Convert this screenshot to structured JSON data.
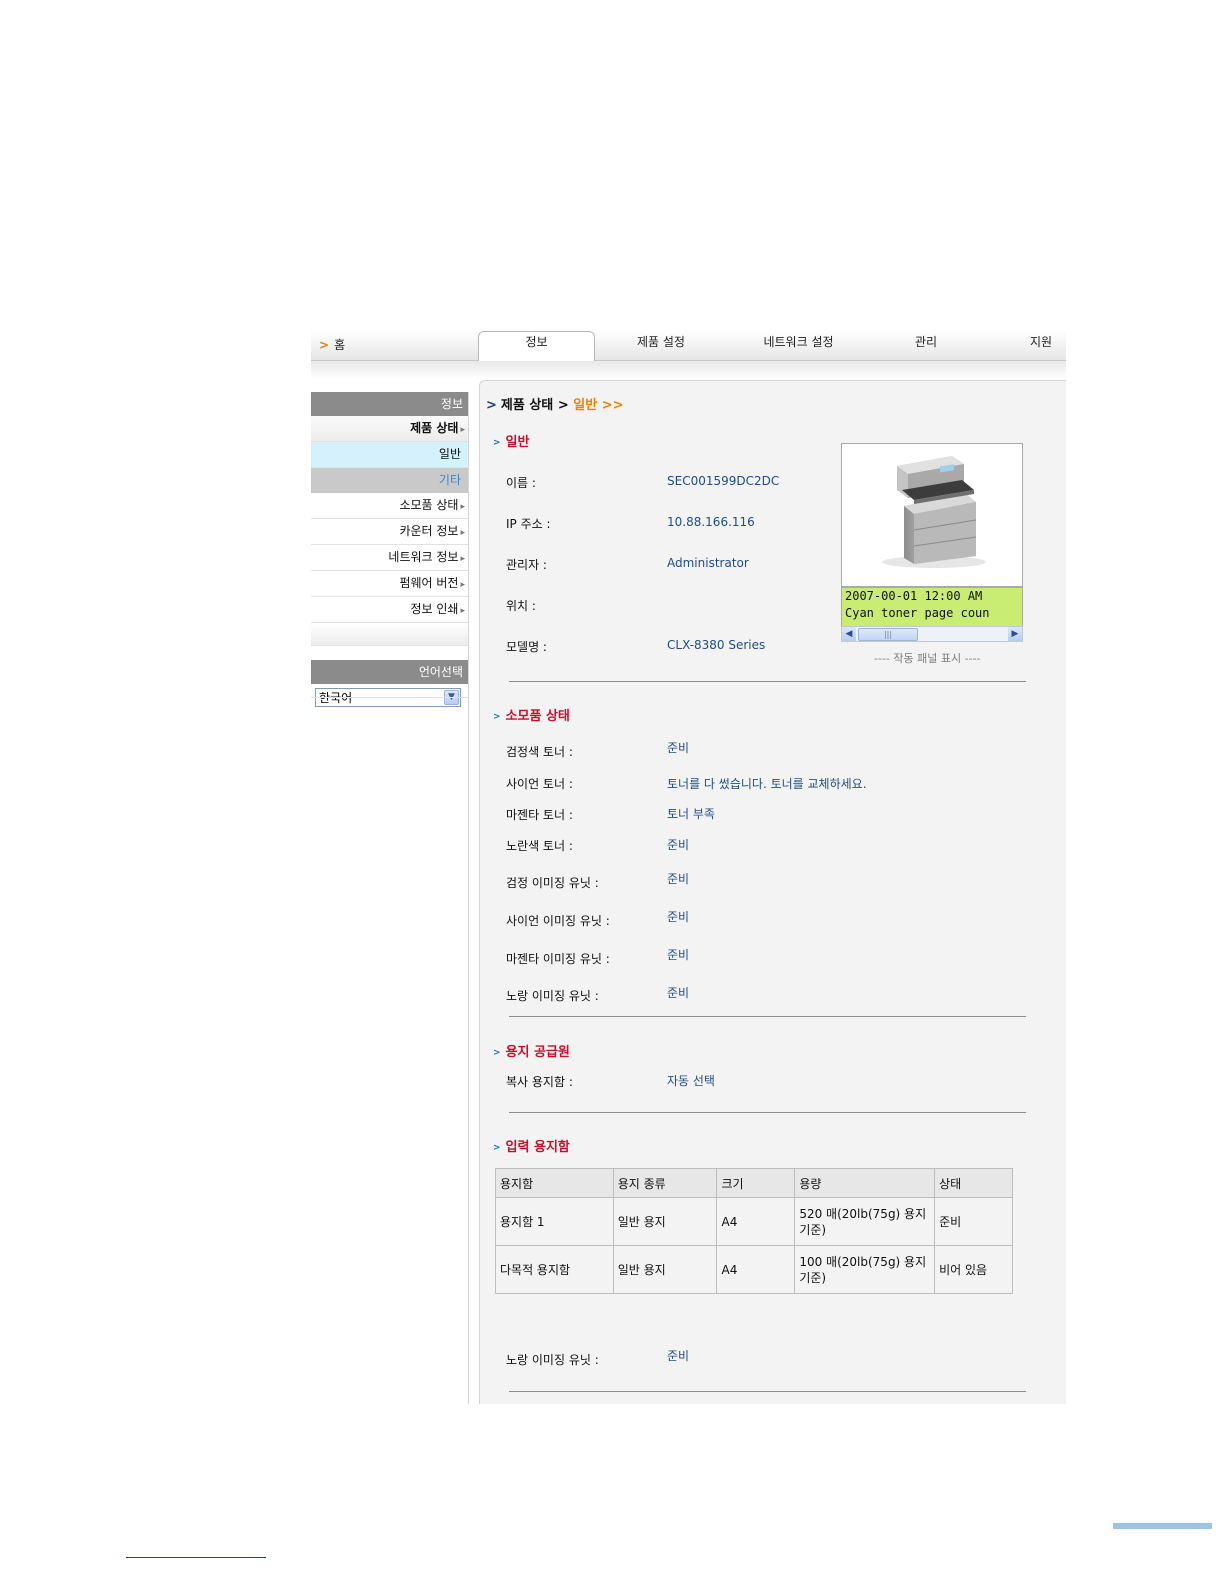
{
  "nav": {
    "home": "홈",
    "tabs": [
      {
        "label": "정보",
        "active": true
      },
      {
        "label": "제품 설정",
        "active": false
      },
      {
        "label": "네트워크 설정",
        "active": false
      },
      {
        "label": "관리",
        "active": false
      },
      {
        "label": "지원",
        "active": false
      }
    ]
  },
  "sidebar": {
    "header": "정보",
    "items": [
      {
        "label": "제품 상태",
        "style": "bold"
      },
      {
        "label": "일반",
        "style": "selected"
      },
      {
        "label": "기타",
        "style": "sub"
      },
      {
        "label": "소모품 상태"
      },
      {
        "label": "카운터 정보"
      },
      {
        "label": "네트워크 정보"
      },
      {
        "label": "펌웨어 버전"
      },
      {
        "label": "정보 인쇄"
      }
    ],
    "language_header": "언어선택",
    "language_value": "한국어"
  },
  "breadcrumb": {
    "section": "제품 상태",
    "separator": ">",
    "current": "일반 >>"
  },
  "general": {
    "title": "일반",
    "fields": [
      {
        "label": "이름 :",
        "value": "SEC001599DC2DC"
      },
      {
        "label": "IP 주소 :",
        "value": "10.88.166.116"
      },
      {
        "label": "관리자 :",
        "value": "Administrator"
      },
      {
        "label": "위치 :",
        "value": ""
      },
      {
        "label": "모델명 :",
        "value": "CLX-8380 Series"
      }
    ],
    "lcd_lines": [
      "2007-00-01 12:00  AM",
      "Cyan toner page coun"
    ],
    "panel_caption": "---- 작동 패널 표시 ----"
  },
  "supplies": {
    "title": "소모품 상태",
    "fields": [
      {
        "label": "검정색 토너 :",
        "value": "준비"
      },
      {
        "label": "사이언 토너 :",
        "value": "토너를 다 썼습니다. 토너를 교체하세요."
      },
      {
        "label": "마젠타 토너 :",
        "value": "토너 부족"
      },
      {
        "label": "노란색 토너 :",
        "value": "준비"
      },
      {
        "label": "검정 이미징 유닛 :",
        "value": "준비"
      },
      {
        "label": "사이언 이미징 유닛 :",
        "value": "준비"
      },
      {
        "label": "마젠타 이미징 유닛 :",
        "value": "준비"
      },
      {
        "label": "노랑 이미징 유닛 :",
        "value": "준비"
      }
    ]
  },
  "paper_source": {
    "title": "용지 공급원",
    "label": "복사 용지함 :",
    "value": "자동 선택"
  },
  "input_tray": {
    "title": "입력 용지함",
    "columns": [
      "용지함",
      "용지 종류",
      "크기",
      "용량",
      "상태"
    ],
    "rows": [
      [
        "용지함 1",
        "일반 용지",
        "A4",
        "520 매(20lb(75g) 용지 기준)",
        "준비"
      ],
      [
        "다목적 용지함",
        "일반 용지",
        "A4",
        "100 매(20lb(75g) 용지 기준)",
        "비어 있음"
      ]
    ]
  },
  "extra": {
    "label": "노랑 이미징 유닛 :",
    "value": "준비"
  },
  "colors": {
    "accent_orange": "#f08000",
    "section_red": "#c8102e",
    "value_blue": "#1f4d8c",
    "lcd_green": "#c9ec73"
  }
}
